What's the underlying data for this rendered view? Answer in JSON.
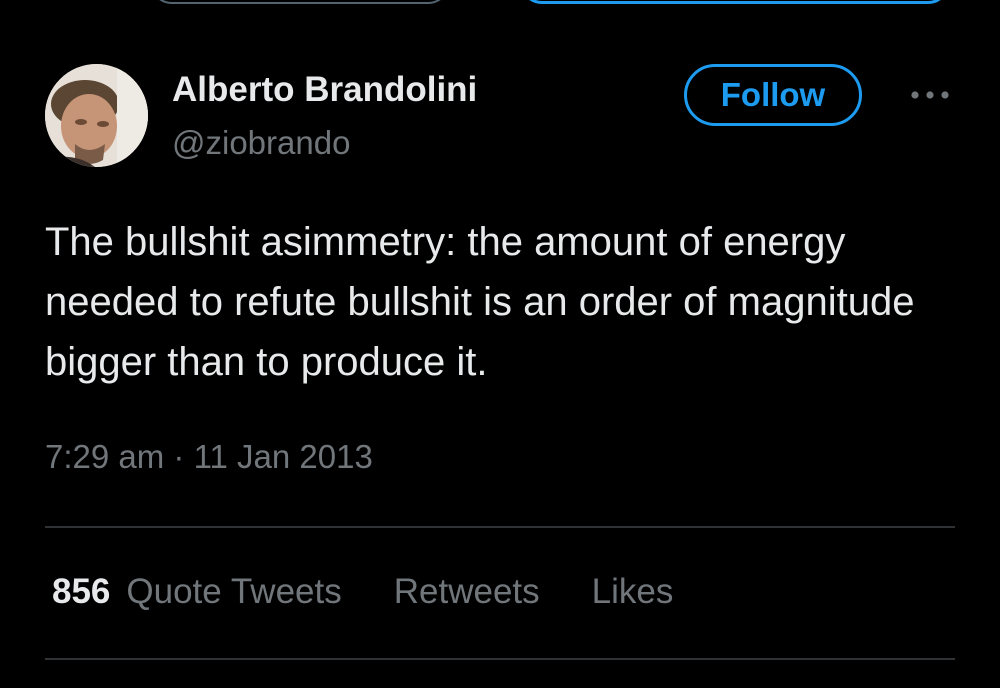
{
  "author": {
    "name": "Alberto Brandolini",
    "handle": "@ziobrando"
  },
  "follow_button": {
    "label": "Follow"
  },
  "tweet": {
    "text": "The bullshit asimmetry: the amount of energy needed to refute bullshit is an order of magnitude bigger than to produce it.",
    "time": "7:29 am",
    "separator": "·",
    "date": "11 Jan 2013"
  },
  "stats": {
    "quote_tweets_count": "856",
    "quote_tweets_label": "Quote Tweets",
    "retweets_label": "Retweets",
    "likes_label": "Likes"
  },
  "icons": {
    "more": "more-horizontal-icon",
    "avatar": "profile-photo"
  },
  "colors": {
    "background": "#000000",
    "text_primary": "#e7e9ea",
    "text_secondary": "#71767b",
    "accent": "#1d9bf0",
    "divider": "#2f3336"
  }
}
